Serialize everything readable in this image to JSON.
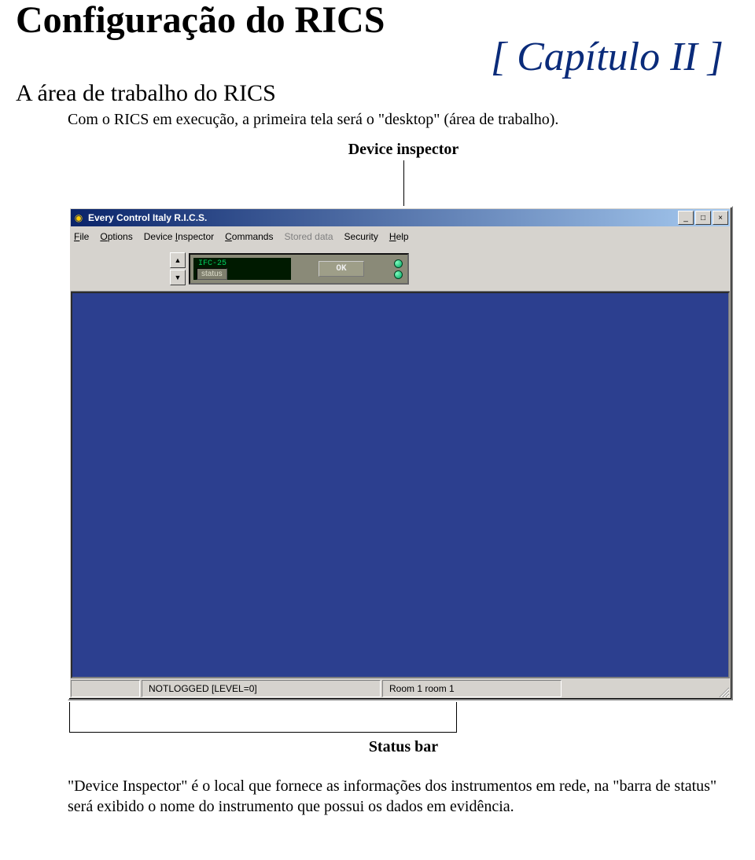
{
  "doc": {
    "main_title": "Configuração do RICS",
    "chapter": "[ Capítulo II ]",
    "section_title": "A área de trabalho do RICS",
    "intro": "Com o RICS em execução, a primeira tela será o \"desktop\" (área de trabalho).",
    "annotation_top": "Device inspector",
    "annotation_bottom": "Status bar",
    "closing": "\"Device Inspector\" é o local que fornece as informações dos instrumentos em rede, na \"barra de status\" será exibido o nome do instrumento que possui os dados em evidência."
  },
  "window": {
    "title": "Every Control Italy  R.I.C.S.",
    "min": "_",
    "max": "□",
    "close": "×",
    "menu": {
      "file": "File",
      "options": "Options",
      "inspector": "Device Inspector",
      "commands": "Commands",
      "stored": "Stored data",
      "security": "Security",
      "help": "Help"
    },
    "device": {
      "name": "IFC-25",
      "status_label": "status",
      "ok": "OK"
    },
    "statusbar": {
      "login": "NOTLOGGED [LEVEL=0]",
      "room": "Room 1 room 1"
    }
  }
}
